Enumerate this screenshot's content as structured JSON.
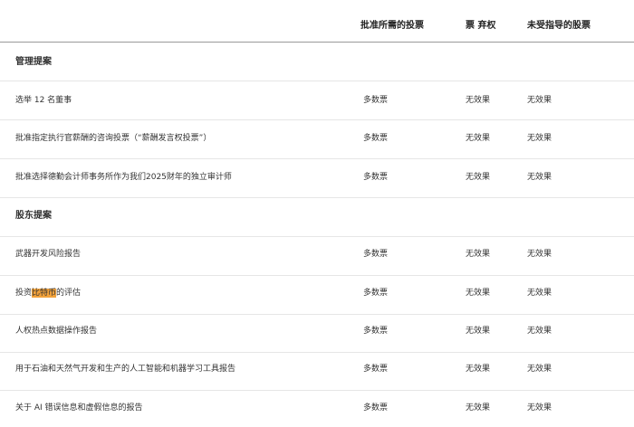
{
  "header": {
    "col_required": "批准所需的投票",
    "col_abstain": "票 弃权",
    "col_broker": "未受指导的股票"
  },
  "management_section": {
    "title": "管理提案",
    "rows": [
      {
        "proposal": "选举 12 名董事",
        "required": "多数票",
        "abstain": "无效果",
        "broker": "无效果"
      },
      {
        "proposal": "批准指定执行官薪酬的咨询投票（“薪酬发言权投票”）",
        "required": "多数票",
        "abstain": "无效果",
        "broker": "无效果"
      },
      {
        "proposal": "批准选择德勤会计师事务所作为我们2025财年的独立审计师",
        "required": "多数票",
        "abstain": "无效果",
        "broker": "无效果"
      }
    ]
  },
  "shareholder_section": {
    "title": "股东提案",
    "rows": [
      {
        "proposal": "武器开发风险报告",
        "required": "多数票",
        "abstain": "无效果",
        "broker": "无效果"
      },
      {
        "proposal_pre": "投资",
        "proposal_highlight": "比特币",
        "proposal_post": "的评估",
        "required": "多数票",
        "abstain": "无效果",
        "broker": "无效果"
      },
      {
        "proposal": "人权热点数据操作报告",
        "required": "多数票",
        "abstain": "无效果",
        "broker": "无效果"
      },
      {
        "proposal": "用于石油和天然气开发和生产的人工智能和机器学习工具报告",
        "required": "多数票",
        "abstain": "无效果",
        "broker": "无效果"
      },
      {
        "proposal": "关于 AI 错误信息和虚假信息的报告",
        "required": "多数票",
        "abstain": "无效果",
        "broker": "无效果"
      }
    ]
  },
  "colors": {
    "highlight": "#f2a23c",
    "header_rule": "#9a9a9a",
    "row_rule": "#e6e6e6"
  }
}
